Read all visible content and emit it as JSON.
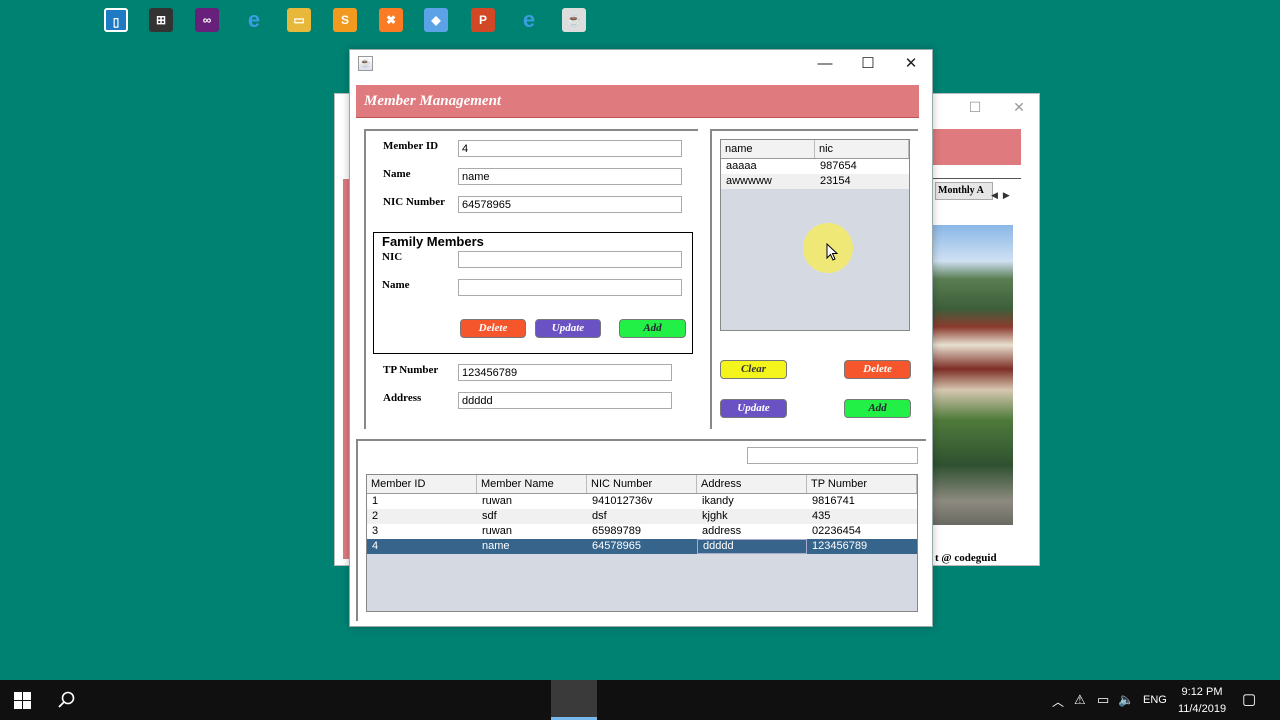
{
  "main_window": {
    "title": "Member Management",
    "fields": {
      "member_id_label": "Member ID",
      "member_id_value": "4",
      "name_label": "Name",
      "name_value": "name",
      "nic_label": "NIC Number",
      "nic_value": "64578965",
      "tp_label": "TP Number",
      "tp_value": "123456789",
      "address_label": "Address",
      "address_value": "ddddd"
    },
    "family": {
      "title": "Family Members",
      "nic_label": "NIC",
      "nic_value": "",
      "name_label": "Name",
      "name_value": "",
      "delete_label": "Delete",
      "update_label": "Update",
      "add_label": "Add"
    },
    "family_table": {
      "columns": [
        "name",
        "nic"
      ],
      "rows": [
        [
          "aaaaa",
          "987654"
        ],
        [
          "awwwww",
          "23154"
        ]
      ]
    },
    "right_buttons": {
      "clear_label": "Clear",
      "delete_label": "Delete",
      "update_label": "Update",
      "add_label": "Add"
    },
    "search_value": "",
    "members_table": {
      "columns": [
        "Member ID",
        "Member Name",
        "NIC Number",
        "Address",
        "TP Number"
      ],
      "rows": [
        [
          "1",
          "ruwan",
          "941012736v",
          "ikandy",
          "9816741"
        ],
        [
          "2",
          "sdf",
          "dsf",
          "kjghk",
          "435"
        ],
        [
          "3",
          "ruwan",
          "65989789",
          "address",
          "02236454"
        ],
        [
          "4",
          "name",
          "64578965",
          "ddddd",
          "123456789"
        ]
      ],
      "selected_row": 3
    }
  },
  "background_window": {
    "tab_label": "Monthly A",
    "credit": "t @ codeguid"
  },
  "taskbar": {
    "language": "ENG",
    "time": "9:12 PM",
    "date": "11/4/2019"
  },
  "colors": {
    "desktop": "#008272",
    "header": "#df7a7e",
    "delete": "#f5562c",
    "update": "#6a52c4",
    "add": "#22f046",
    "clear": "#f5f51e",
    "selection": "#36648b"
  }
}
